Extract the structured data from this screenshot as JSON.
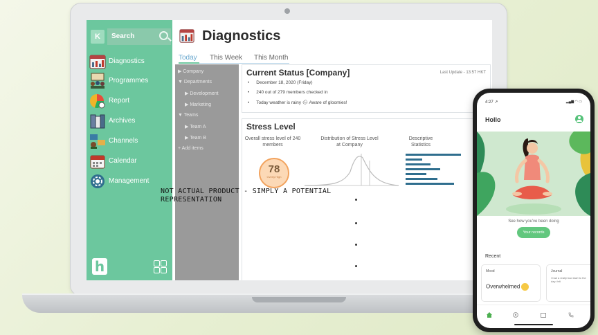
{
  "sidebar": {
    "k_label": "K",
    "search_label": "Search",
    "items": [
      {
        "label": "Diagnostics",
        "icon": "diagnostics-icon"
      },
      {
        "label": "Programmes",
        "icon": "programmes-icon"
      },
      {
        "label": "Report",
        "icon": "report-icon"
      },
      {
        "label": "Archives",
        "icon": "archives-icon"
      },
      {
        "label": "Channels",
        "icon": "channels-icon"
      },
      {
        "label": "Calendar",
        "icon": "calendar-icon"
      },
      {
        "label": "Management",
        "icon": "gear-icon"
      }
    ],
    "logo": "h"
  },
  "page": {
    "title": "Diagnostics",
    "tabs": [
      "Today",
      "This Week",
      "This Month"
    ]
  },
  "tree": {
    "company": "Company",
    "departments": "Departments",
    "development": "Development",
    "marketing": "Marketing",
    "teams": "Teams",
    "team_a": "Team A",
    "team_b": "Team B",
    "add_items": "Add items"
  },
  "status": {
    "title": "Current Status [Company]",
    "last_update": "Last Update - 13:57 HKT",
    "bullets": [
      "December 18, 2020 (Friday)",
      "240 out of 279 members checked in",
      "Today weather is rainy 🌧 Aware of gloomies!"
    ]
  },
  "stress": {
    "title": "Stress Level",
    "col1": "Overall stress level of 240 members",
    "col2": "Distribution of Stress Level at Company",
    "col3": "Descriptive Statistics",
    "value": "78",
    "value_label": "Overly High"
  },
  "disclaimer": "NOT ACTUAL PRODUCT - SIMPLY A POTENTIAL REPRESENTATION",
  "phone": {
    "time": "4:27 ↗",
    "greeting": "Hollo",
    "see_text": "See how you've been doing",
    "records_button": "Your records",
    "recent": "Recent",
    "mood_title": "Mood",
    "mood_value": "Overwhelmed",
    "journal_title": "Journal",
    "journal_text": "I had a really bad start to the day. felt"
  },
  "colors": {
    "accent": "#6cc79e",
    "tree_bg": "#9a9a9a",
    "badge": "#f2a35e",
    "bar": "#2f6e8e"
  }
}
